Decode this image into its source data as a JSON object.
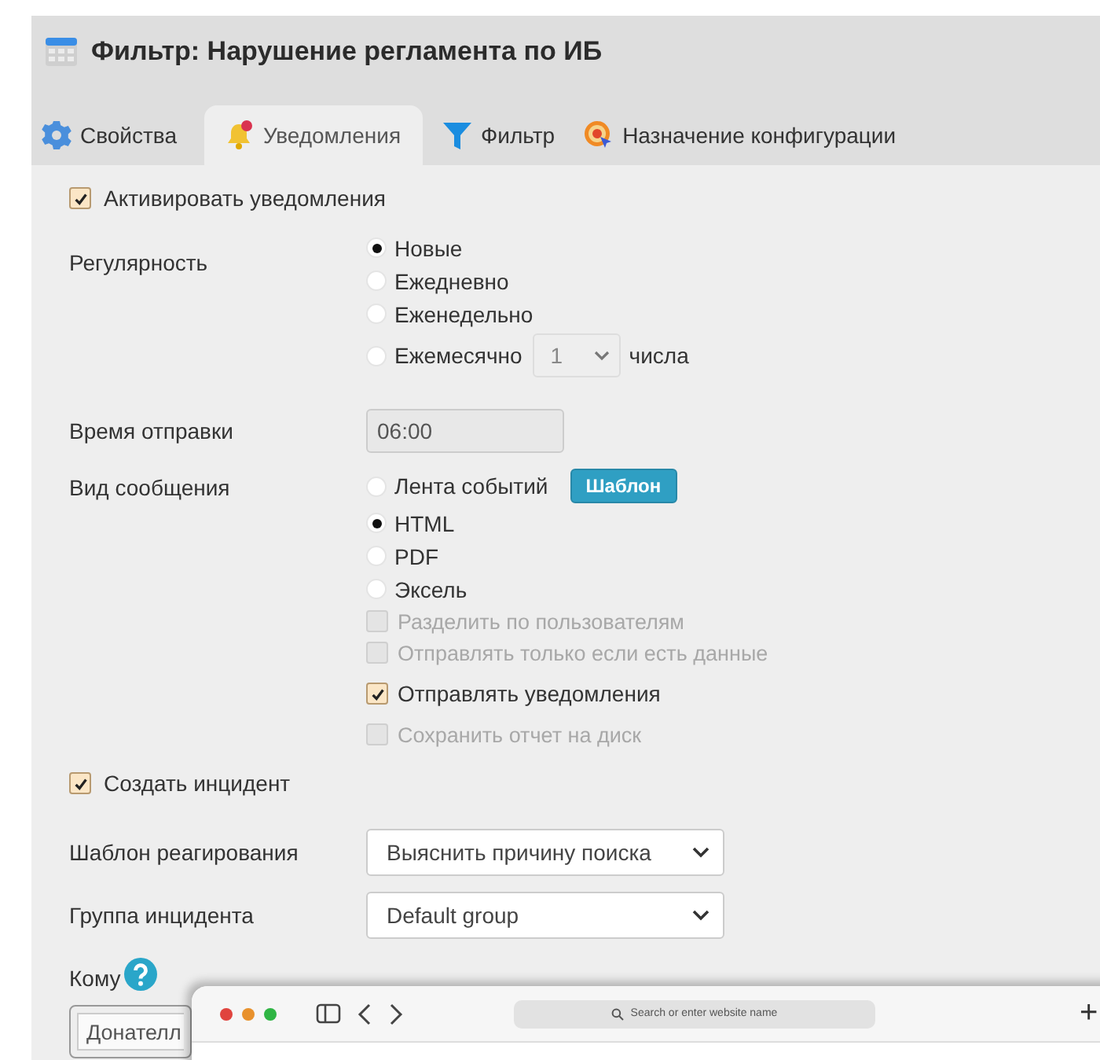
{
  "window": {
    "title": "Фильтр: Нарушение регламента по ИБ"
  },
  "tabs": [
    {
      "label": "Свойства",
      "selected": false
    },
    {
      "label": "Уведомления",
      "selected": true
    },
    {
      "label": "Фильтр",
      "selected": false
    },
    {
      "label": "Назначение конфигурации",
      "selected": false
    }
  ],
  "activate_notifications": {
    "label": "Активировать уведомления",
    "checked": true
  },
  "regularity": {
    "label": "Регулярность",
    "options": [
      {
        "label": "Новые",
        "selected": true
      },
      {
        "label": "Ежедневно",
        "selected": false
      },
      {
        "label": "Еженедельно",
        "selected": false
      },
      {
        "label": "Ежемесячно",
        "selected": false,
        "day": "1",
        "suffix": "числа"
      }
    ]
  },
  "send_time": {
    "label": "Время отправки",
    "value": "06:00"
  },
  "message_type": {
    "label": "Вид сообщения",
    "template_button": "Шаблон",
    "options": [
      {
        "label": "Лента событий",
        "selected": false
      },
      {
        "label": "HTML",
        "selected": true
      },
      {
        "label": "PDF",
        "selected": false
      },
      {
        "label": "Эксель",
        "selected": false
      }
    ],
    "checkboxes": [
      {
        "label": "Разделить по пользователям",
        "checked": false,
        "disabled": true
      },
      {
        "label": "Отправлять только если есть данные",
        "checked": false,
        "disabled": true
      },
      {
        "label": "Отправлять уведомления",
        "checked": true,
        "disabled": false
      },
      {
        "label": "Сохранить отчет на диск",
        "checked": false,
        "disabled": true
      }
    ]
  },
  "create_incident": {
    "label": "Создать инцидент",
    "checked": true
  },
  "response_template": {
    "label": "Шаблон реагирования",
    "value": "Выяснить причину поиска"
  },
  "incident_group": {
    "label": "Группа инцидента",
    "value": "Default group"
  },
  "recipients": {
    "label": "Кому",
    "value": "Донателл"
  },
  "browser_overlay": {
    "address_placeholder": "Search or enter website name",
    "new_tab": "+"
  }
}
